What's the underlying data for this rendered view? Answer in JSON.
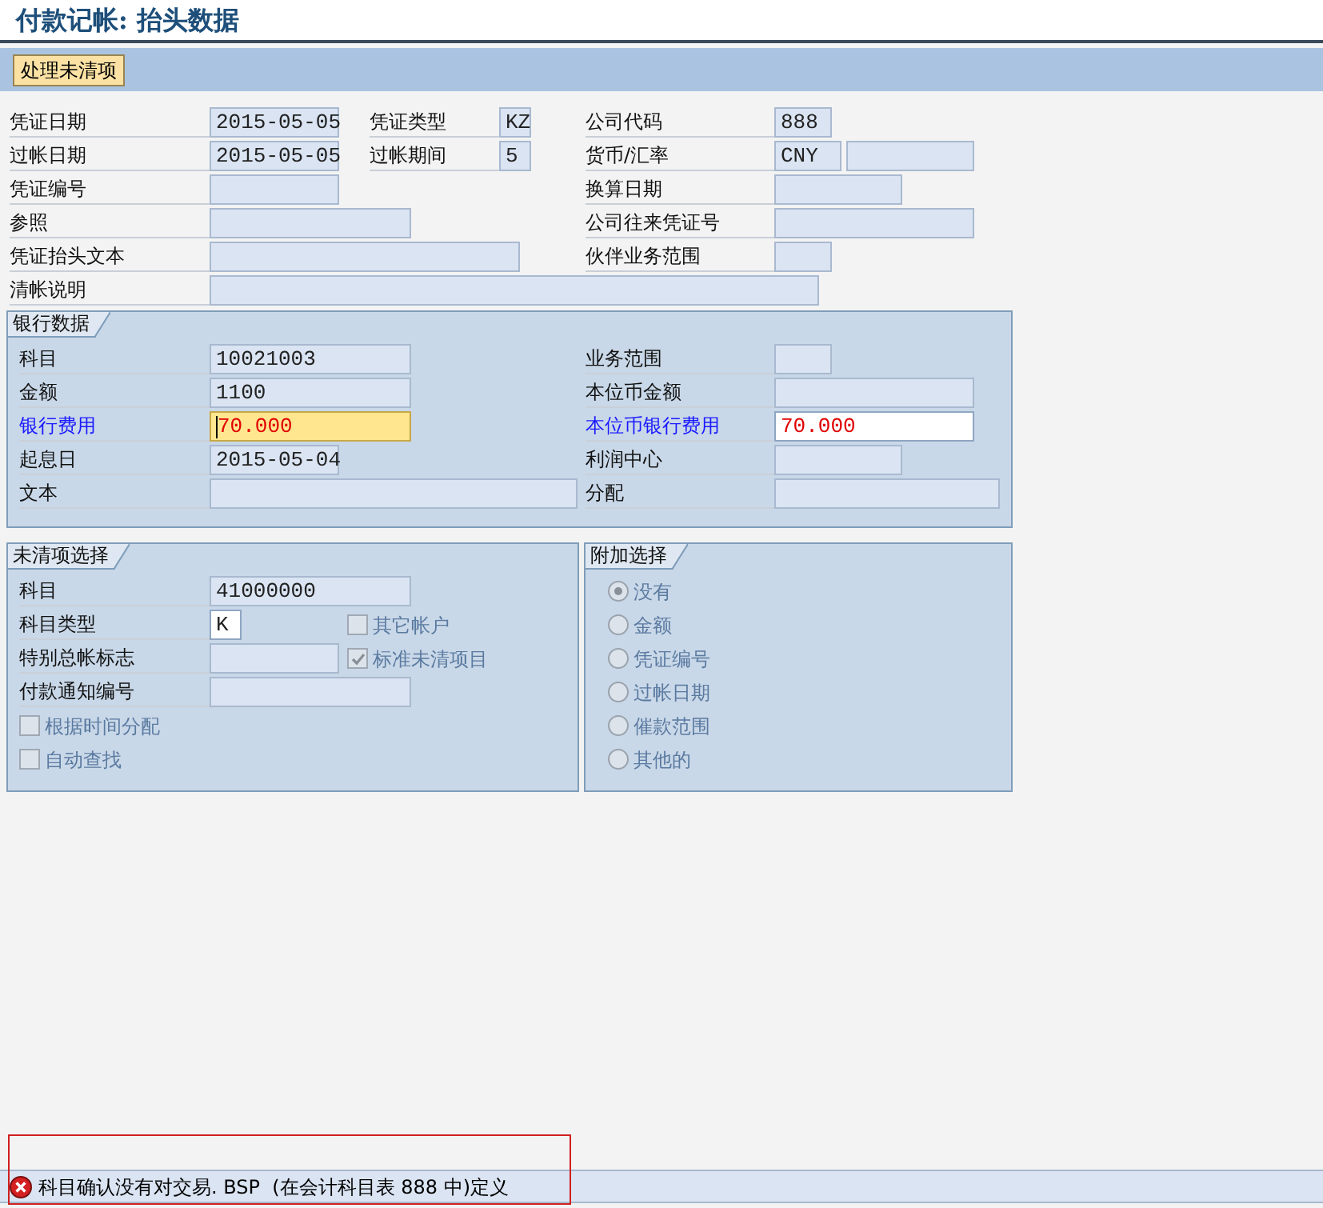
{
  "title": "付款记帐: 抬头数据",
  "toolbar": [
    {
      "label": "处理未清项"
    }
  ],
  "header": [
    {
      "left": {
        "label": "凭证日期",
        "fields": [
          {
            "value": "2015-05-05",
            "kind": "display"
          }
        ]
      },
      "middle": {
        "label": "凭证类型",
        "fields": [
          {
            "value": "KZ",
            "kind": "display"
          }
        ]
      },
      "right": {
        "label": "公司代码",
        "fields": [
          {
            "value": "888",
            "kind": "display"
          }
        ]
      }
    },
    {
      "left": {
        "label": "过帐日期",
        "fields": [
          {
            "value": "2015-05-05",
            "kind": "display"
          }
        ]
      },
      "middle": {
        "label": "过帐期间",
        "fields": [
          {
            "value": "5",
            "kind": "display"
          }
        ]
      },
      "right": {
        "label": "货币/汇率",
        "fields": [
          {
            "value": "CNY",
            "kind": "display"
          },
          {
            "kind": "display"
          }
        ]
      }
    },
    {
      "left": {
        "label": "凭证编号",
        "fields": [
          {
            "kind": "display"
          }
        ]
      },
      "right": {
        "label": "换算日期",
        "fields": [
          {
            "kind": "display"
          }
        ]
      }
    },
    {
      "left": {
        "label": "参照",
        "fields": [
          {
            "kind": "display"
          }
        ]
      },
      "right": {
        "label": "公司往来凭证号",
        "fields": [
          {
            "kind": "display"
          }
        ]
      }
    },
    {
      "left": {
        "label": "凭证抬头文本",
        "fields": [
          {
            "kind": "display"
          }
        ]
      },
      "right": {
        "label": "伙伴业务范围",
        "fields": [
          {
            "kind": "display"
          }
        ]
      }
    },
    {
      "left": {
        "label": "清帐说明",
        "fields": [
          {
            "kind": "display"
          }
        ]
      }
    }
  ],
  "bank_data": {
    "title": "银行数据",
    "rows": [
      {
        "modified": false,
        "left": {
          "label": "科目",
          "field": {
            "value": "10021003",
            "kind": "display"
          }
        },
        "right": {
          "label": "业务范围",
          "field": {
            "kind": "display"
          }
        }
      },
      {
        "modified": false,
        "left": {
          "label": "金额",
          "field": {
            "value": "1100",
            "kind": "display"
          }
        },
        "right": {
          "label": "本位币金额",
          "field": {
            "kind": "display"
          }
        }
      },
      {
        "modified": true,
        "left": {
          "label": "银行费用",
          "field": {
            "value": "70.000",
            "kind": "focused"
          }
        },
        "right": {
          "label": "本位币银行费用",
          "field": {
            "value": "70.000",
            "kind": "input"
          }
        }
      },
      {
        "modified": false,
        "left": {
          "label": "起息日",
          "field": {
            "value": "2015-05-04",
            "kind": "display"
          }
        },
        "right": {
          "label": "利润中心",
          "field": {
            "kind": "display"
          }
        }
      },
      {
        "modified": false,
        "left": {
          "label": "文本",
          "field": {
            "kind": "display"
          }
        },
        "right": {
          "label": "分配",
          "field": {
            "kind": "display"
          }
        }
      }
    ]
  },
  "open_item_selection": {
    "title": "未清项选择",
    "rows": [
      {
        "kind": "field",
        "label": "科目",
        "field": {
          "value": "41000000",
          "kind": "display"
        }
      },
      {
        "kind": "field",
        "label": "科目类型",
        "field": {
          "value": "K",
          "kind": "input"
        },
        "checkbox": {
          "label": "其它帐户",
          "checked": false,
          "disabled": true
        }
      },
      {
        "kind": "field",
        "label": "特别总帐标志",
        "field": {
          "kind": "display"
        },
        "checkbox": {
          "label": "标准未清项目",
          "checked": true,
          "disabled": true
        }
      },
      {
        "kind": "field",
        "label": "付款通知编号",
        "field": {
          "kind": "display"
        }
      },
      {
        "kind": "checkbox",
        "checkbox": {
          "label": "根据时间分配",
          "checked": false,
          "disabled": true
        }
      },
      {
        "kind": "checkbox",
        "checkbox": {
          "label": "自动查找",
          "checked": false,
          "disabled": true
        }
      }
    ]
  },
  "additional_selection": {
    "title": "附加选择",
    "options": [
      {
        "label": "没有",
        "selected": true,
        "disabled": true
      },
      {
        "label": "金额",
        "selected": false,
        "disabled": true
      },
      {
        "label": "凭证编号",
        "selected": false,
        "disabled": true
      },
      {
        "label": "过帐日期",
        "selected": false,
        "disabled": true
      },
      {
        "label": "催款范围",
        "selected": false,
        "disabled": true
      },
      {
        "label": "其他的",
        "selected": false,
        "disabled": true
      }
    ]
  },
  "status_bar": {
    "error": true,
    "text": "科目确认没有对交易. BSP  (在会计科目表 888 中)定义"
  }
}
